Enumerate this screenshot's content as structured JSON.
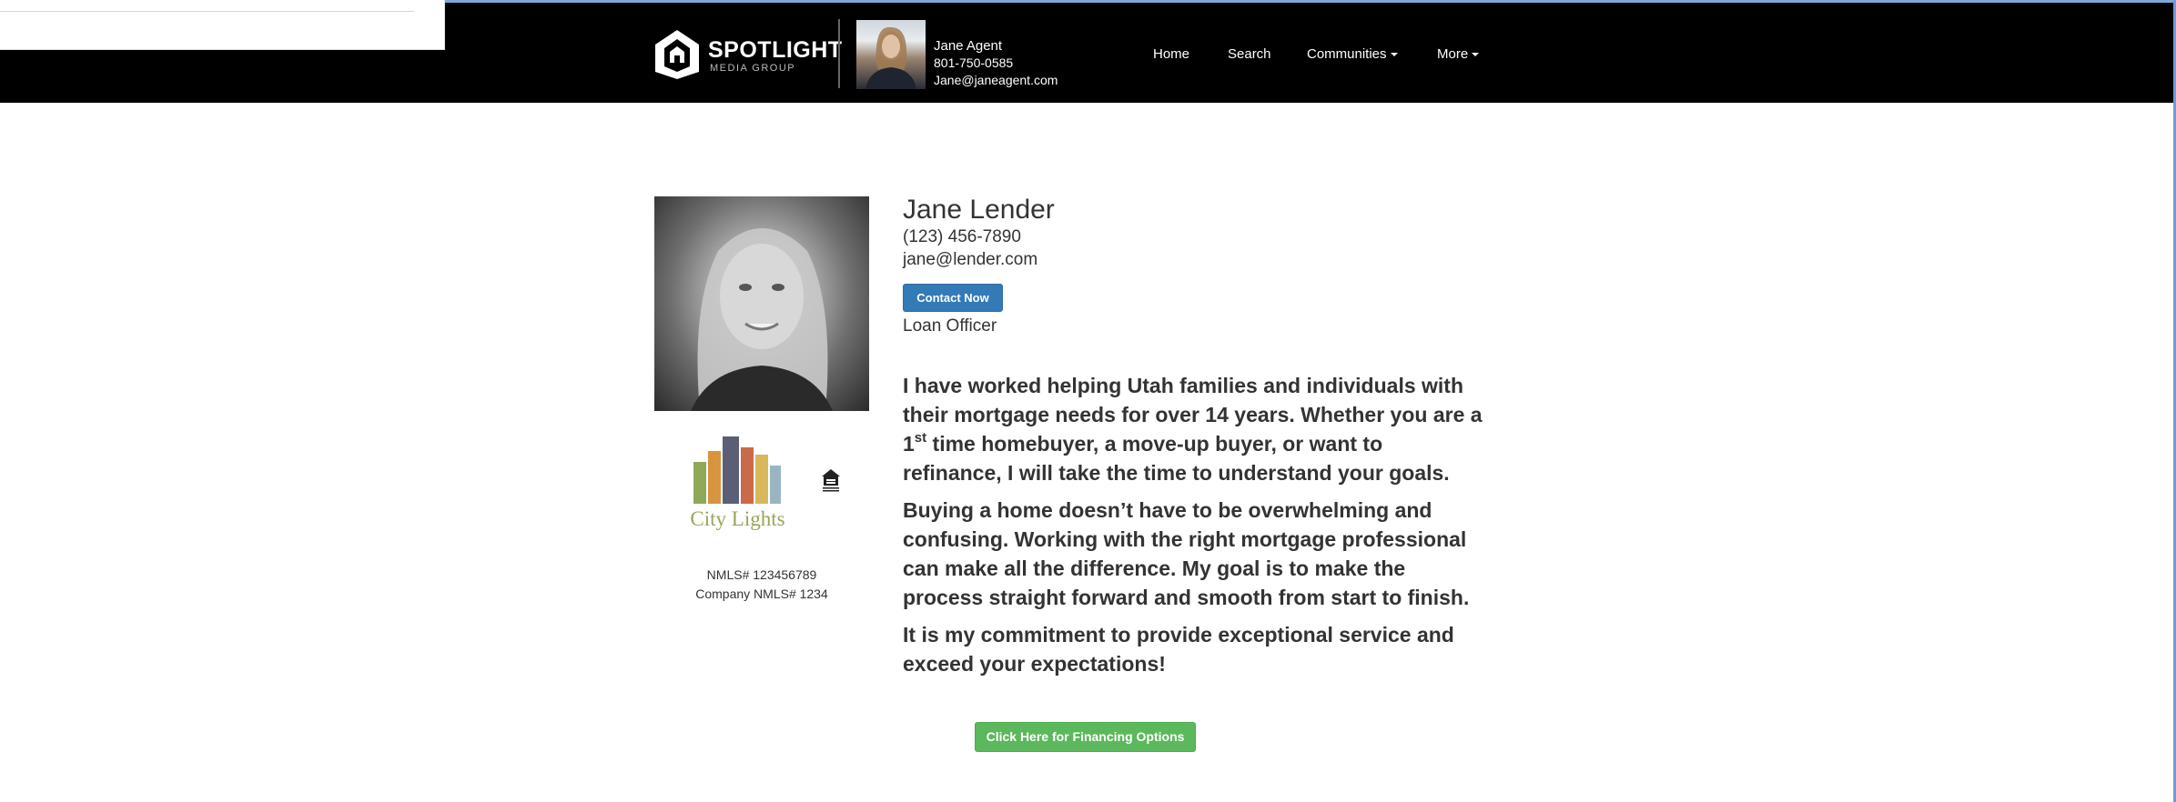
{
  "navbar": {
    "brand": {
      "name": "SPOTLIGHT",
      "tagline": "MEDIA GROUP"
    },
    "agent": {
      "name": "Jane Agent",
      "phone": "801-750-0585",
      "email": "Jane@janeagent.com"
    },
    "menu": [
      {
        "label": "Home"
      },
      {
        "label": "Search"
      },
      {
        "label": "Communities"
      },
      {
        "label": "More"
      }
    ],
    "background": "#000000"
  },
  "profile": {
    "name": "Jane Lender",
    "phone": "(123) 456-7890",
    "email": "jane@lender.com",
    "contact_button": "Contact Now",
    "role": "Loan Officer",
    "company_logo_text": "City Lights",
    "nmls": "NMLS# 123456789",
    "company_nmls": "Company NMLS# 1234"
  },
  "bio": {
    "p1_before": "I have worked helping Utah families and individuals with their mortgage needs for over 14 years. Whether you are a 1",
    "p1_sup": "st",
    "p1_after": " time homebuyer, a move-up buyer, or want to refinance, I will take the time to understand your goals.",
    "p2": "Buying a home doesn’t have to be overwhelming and confusing. Working with the right mortgage professional can make all the difference. My goal is to make the process straight forward and smooth from start to finish.",
    "p3": "It is my commitment to provide exceptional service and exceed your expectations!"
  },
  "financing_button": "Click Here for Financing Options",
  "colors": {
    "primary_button": "#337ab7",
    "success_button": "#5cb85c",
    "logo_text": "#9aa35a"
  },
  "icons": {
    "brand_logo": "house-logo-icon",
    "equal_housing": "equal-housing-icon",
    "dropdown": "caret-down-icon"
  }
}
